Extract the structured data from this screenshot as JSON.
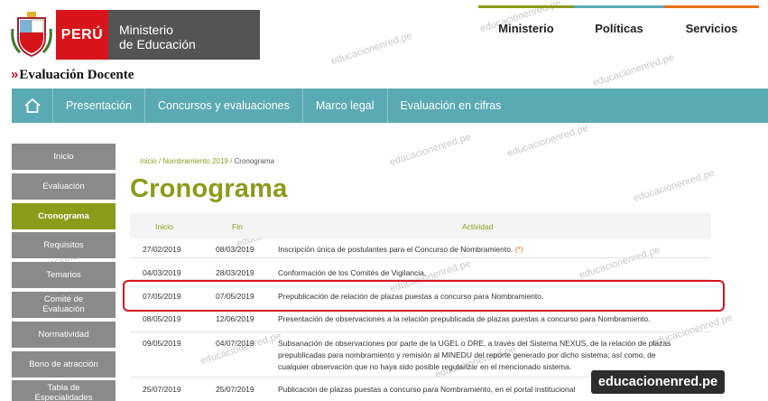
{
  "header": {
    "country": "PERÚ",
    "ministry_line1": "Ministerio",
    "ministry_line2": "de Educación",
    "brand_chevron": "»",
    "brand": "Evaluación Docente"
  },
  "topnav": [
    {
      "label": "Ministerio",
      "color": "#8b9b1a"
    },
    {
      "label": "Políticas",
      "color": "#5aaab3"
    },
    {
      "label": "Servicios",
      "color": "#e8701a"
    }
  ],
  "mainnav": {
    "home_icon": "home-icon",
    "links": [
      "Presentación",
      "Concursos y evaluaciones",
      "Marco legal",
      "Evaluación en cifras"
    ]
  },
  "sidebar": [
    {
      "label": "Inicio",
      "active": false
    },
    {
      "label": "Evaluación",
      "active": false
    },
    {
      "label": "Cronograma",
      "active": true
    },
    {
      "label": "Requisitos",
      "active": false
    },
    {
      "label": "Temarios",
      "active": false
    },
    {
      "label": "Comité de Evaluación",
      "active": false
    },
    {
      "label": "Normatividad",
      "active": false
    },
    {
      "label": "Bono de atracción",
      "active": false
    },
    {
      "label": "Tabla de Especialidades Afines",
      "active": false
    }
  ],
  "breadcrumb": {
    "home": "Inicio",
    "sep1": " / ",
    "section": "Nombramiento 2019",
    "sep2": " / ",
    "current": "Cronograma"
  },
  "page_title": "Cronograma",
  "table": {
    "headers": [
      "Inicio",
      "Fin",
      "Actividad"
    ],
    "rows": [
      {
        "start": "27/02/2019",
        "end": "08/03/2019",
        "activity": "Inscripción única de postulantes para el Concurso de Nombramiento.",
        "mark": "(*)"
      },
      {
        "start": "04/03/2019",
        "end": "28/03/2019",
        "activity": "Conformación de los Comités de Vigilancia.",
        "mark": ""
      },
      {
        "start": "07/05/2019",
        "end": "07/05/2019",
        "activity": "Prepublicación de relación de plazas puestas a concurso para Nombramiento.",
        "mark": ""
      },
      {
        "start": "08/05/2019",
        "end": "12/06/2019",
        "activity": "Presentación de observaciones a la relación prepublicada de plazas puestas a concurso para Nombramiento.",
        "mark": ""
      },
      {
        "start": "09/05/2019",
        "end": "04/07/2019",
        "activity_lines": [
          "Subsanación de observaciones por parte de la UGEL o DRE, a través del Sistema NEXUS, de la relación de plazas",
          "prepublicadas para nombramiento y remisión al MINEDU del reporte generado por dicho sistema; así como, de",
          "cualquier observación que no haya sido posible regularizar en el mencionado sistema."
        ],
        "mark": ""
      },
      {
        "start": "25/07/2019",
        "end": "25/07/2019",
        "activity": "Publicación de plazas puestas a concurso para Nombramiento, en el portal institucional",
        "mark": ""
      }
    ]
  },
  "watermark": "educacionenred.pe",
  "badge": "educacionenred.pe",
  "colors": {
    "olive": "#8b9b1a",
    "teal": "#5aaab3",
    "red": "#d7141a",
    "orange": "#e8701a"
  }
}
